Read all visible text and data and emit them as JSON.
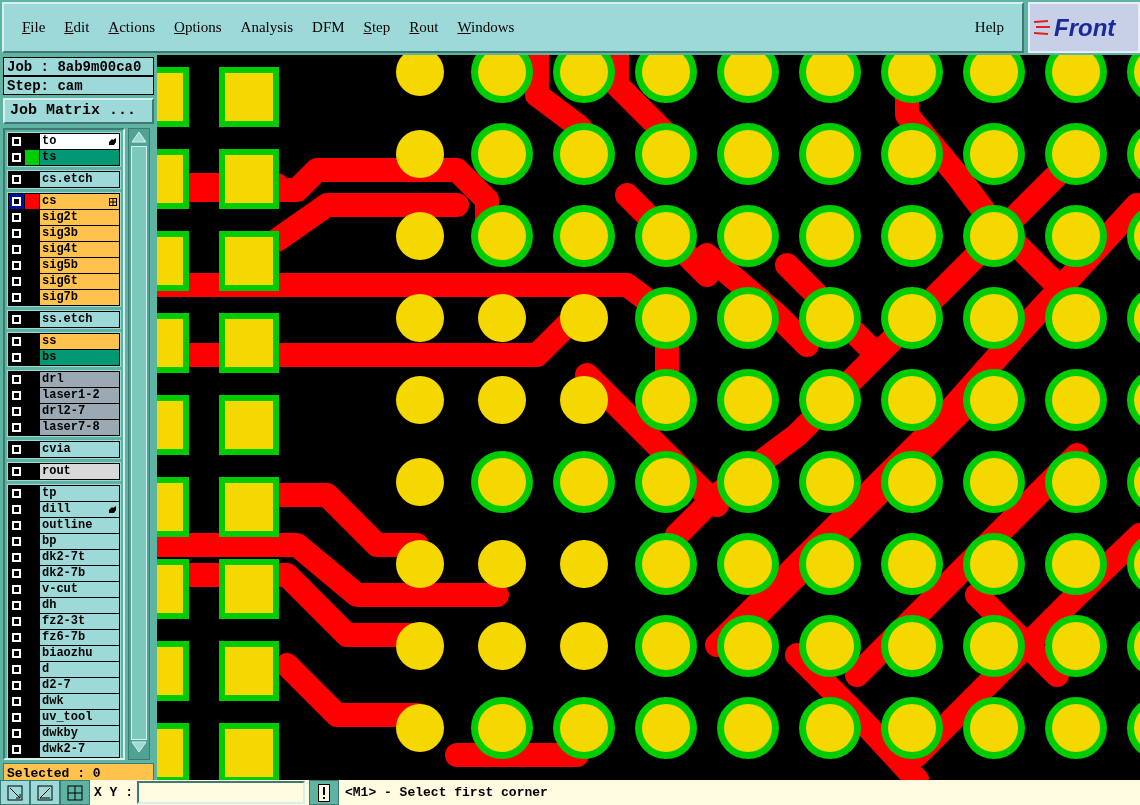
{
  "menu": [
    {
      "label": "File",
      "mnemonic": true
    },
    {
      "label": "Edit",
      "mnemonic": true
    },
    {
      "label": "Actions",
      "mnemonic": true
    },
    {
      "label": "Options",
      "mnemonic": true
    },
    {
      "label": "Analysis",
      "mnemonic": false
    },
    {
      "label": "DFM",
      "mnemonic": false
    },
    {
      "label": "Step",
      "mnemonic": true
    },
    {
      "label": "Rout",
      "mnemonic": true
    },
    {
      "label": "Windows",
      "mnemonic": true
    }
  ],
  "help": "Help",
  "logo": "Front",
  "job": "Job : 8ab9m00ca0",
  "step": "Step: cam",
  "job_matrix_button": "Job Matrix ...",
  "layer_groups": [
    {
      "layers": [
        {
          "name": "to",
          "kind": "document",
          "selected": false,
          "pointer_mark": true
        },
        {
          "name": "ts",
          "kind": "mask",
          "selected": false,
          "color": "#00cc00"
        }
      ]
    },
    {
      "layers": [
        {
          "name": "cs.etch",
          "kind": "misc",
          "selected": false
        }
      ]
    },
    {
      "layers": [
        {
          "name": "cs",
          "kind": "signal",
          "selected": true,
          "color": "#ff0000",
          "grid_mark": true
        },
        {
          "name": "sig2t",
          "kind": "signal",
          "selected": false
        },
        {
          "name": "sig3b",
          "kind": "signal",
          "selected": false
        },
        {
          "name": "sig4t",
          "kind": "signal",
          "selected": false
        },
        {
          "name": "sig5b",
          "kind": "signal",
          "selected": false
        },
        {
          "name": "sig6t",
          "kind": "signal",
          "selected": false
        },
        {
          "name": "sig7b",
          "kind": "signal",
          "selected": false
        }
      ]
    },
    {
      "layers": [
        {
          "name": "ss.etch",
          "kind": "misc",
          "selected": false
        }
      ]
    },
    {
      "layers": [
        {
          "name": "ss",
          "kind": "signal",
          "selected": false
        },
        {
          "name": "bs",
          "kind": "mask",
          "selected": false
        }
      ]
    },
    {
      "layers": [
        {
          "name": "drl",
          "kind": "drill",
          "selected": false
        },
        {
          "name": "laser1-2",
          "kind": "drill",
          "selected": false
        },
        {
          "name": "drl2-7",
          "kind": "drill",
          "selected": false
        },
        {
          "name": "laser7-8",
          "kind": "drill",
          "selected": false
        }
      ]
    },
    {
      "layers": [
        {
          "name": "cvia",
          "kind": "misc",
          "selected": false
        }
      ]
    },
    {
      "layers": [
        {
          "name": "rout",
          "kind": "rout",
          "selected": false
        }
      ]
    },
    {
      "layers": [
        {
          "name": "tp",
          "kind": "misc",
          "selected": false
        },
        {
          "name": "dill",
          "kind": "misc",
          "selected": false,
          "pointer_mark": true
        },
        {
          "name": "outline",
          "kind": "misc",
          "selected": false
        },
        {
          "name": "bp",
          "kind": "misc",
          "selected": false
        },
        {
          "name": "dk2-7t",
          "kind": "misc",
          "selected": false
        },
        {
          "name": "dk2-7b",
          "kind": "misc",
          "selected": false
        },
        {
          "name": "v-cut",
          "kind": "misc",
          "selected": false
        },
        {
          "name": "dh",
          "kind": "misc",
          "selected": false
        },
        {
          "name": "fz2-3t",
          "kind": "misc",
          "selected": false
        },
        {
          "name": "fz6-7b",
          "kind": "misc",
          "selected": false
        },
        {
          "name": "biaozhu",
          "kind": "misc",
          "selected": false
        },
        {
          "name": "d",
          "kind": "misc",
          "selected": false
        },
        {
          "name": "d2-7",
          "kind": "misc",
          "selected": false
        },
        {
          "name": "dwk",
          "kind": "misc",
          "selected": false
        },
        {
          "name": "uv_tool",
          "kind": "misc",
          "selected": false
        },
        {
          "name": "dwkby",
          "kind": "misc",
          "selected": false
        },
        {
          "name": "dwk2-7",
          "kind": "misc",
          "selected": false
        }
      ]
    }
  ],
  "selected_count": "Selected : 0",
  "coords_label": "X Y :",
  "message": "<M1> - Select first corner"
}
